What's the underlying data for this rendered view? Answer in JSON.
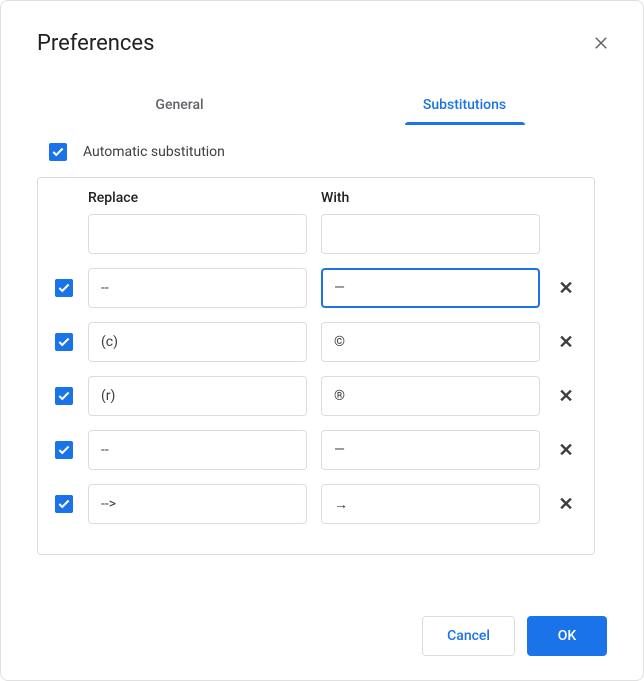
{
  "dialog": {
    "title": "Preferences"
  },
  "tabs": {
    "general": "General",
    "substitutions": "Substitutions"
  },
  "auto_substitution": {
    "label": "Automatic substitution",
    "checked": true
  },
  "columns": {
    "replace": "Replace",
    "with": "With"
  },
  "rows": [
    {
      "enabled": null,
      "replace": "",
      "with": "",
      "deletable": false,
      "with_focused": false
    },
    {
      "enabled": true,
      "replace": "--",
      "with": "—",
      "deletable": true,
      "with_focused": true
    },
    {
      "enabled": true,
      "replace": "(c)",
      "with": "©",
      "deletable": true,
      "with_focused": false
    },
    {
      "enabled": true,
      "replace": "(r)",
      "with": "®",
      "deletable": true,
      "with_focused": false
    },
    {
      "enabled": true,
      "replace": "--",
      "with": "—",
      "deletable": true,
      "with_focused": false
    },
    {
      "enabled": true,
      "replace": "-->",
      "with": "→",
      "deletable": true,
      "with_focused": false
    }
  ],
  "buttons": {
    "cancel": "Cancel",
    "ok": "OK"
  }
}
